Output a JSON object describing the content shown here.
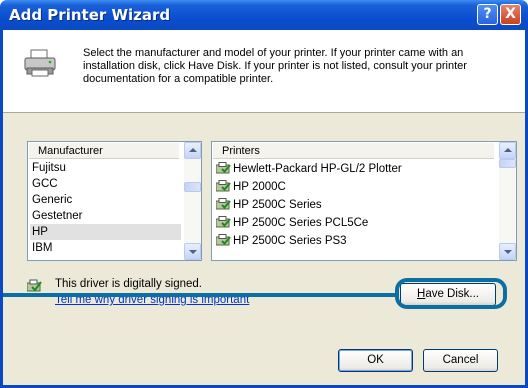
{
  "window": {
    "title": "Add Printer Wizard",
    "help_glyph": "?",
    "close_glyph": "X"
  },
  "intro_text": "Select the manufacturer and model of your printer. If your printer came with an installation disk, click Have Disk. If your printer is not listed, consult your printer documentation for a compatible printer.",
  "manufacturer_list": {
    "header": "Manufacturer",
    "items": [
      "Fujitsu",
      "GCC",
      "Generic",
      "Gestetner",
      "HP",
      "IBM"
    ],
    "selected": "HP"
  },
  "printer_list": {
    "header": "Printers",
    "items": [
      "Hewlett-Packard HP-GL/2 Plotter",
      "HP 2000C",
      "HP 2500C Series",
      "HP 2500C Series PCL5Ce",
      "HP 2500C Series PS3"
    ]
  },
  "signing": {
    "status": "This driver is digitally signed.",
    "link": "Tell me why driver signing is important"
  },
  "buttons": {
    "have_disk": "Have Disk...",
    "ok": "OK",
    "cancel": "Cancel"
  },
  "colors": {
    "title_bar": "#0a49c2",
    "dialog_face": "#ece9d8",
    "callout": "#0b6fa4",
    "link": "#0033cc"
  },
  "icons": {
    "header": "printer-icon",
    "driver": "signed-driver-icon"
  }
}
